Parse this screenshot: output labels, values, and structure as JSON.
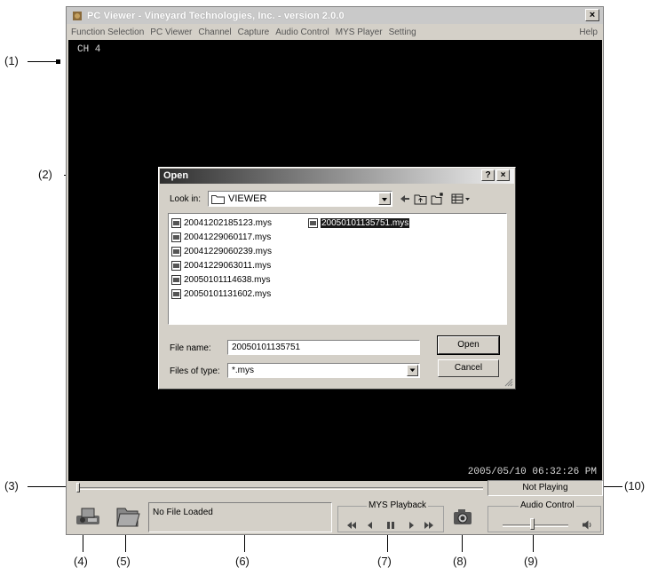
{
  "window": {
    "title": "PC Viewer - Vineyard Technologies, Inc. - version 2.0.0",
    "close_glyph": "×"
  },
  "menu": {
    "items": [
      "Function Selection",
      "PC Viewer",
      "Channel",
      "Capture",
      "Audio Control",
      "MYS Player",
      "Setting"
    ],
    "help": "Help"
  },
  "video": {
    "channel": "CH 4",
    "timestamp": "2005/05/10 06:32:26 PM"
  },
  "dialog": {
    "title": "Open",
    "help_glyph": "?",
    "close_glyph": "×",
    "look_in_label": "Look in:",
    "look_in_value": "VIEWER",
    "files": [
      "20041202185123.mys",
      "20041229060117.mys",
      "20041229060239.mys",
      "20041229063011.mys",
      "20050101114638.mys",
      "20050101131602.mys",
      "20050101135751.mys"
    ],
    "selected_file_index": 6,
    "file_name_label": "File name:",
    "file_name_value": "20050101135751",
    "file_type_label": "Files of type:",
    "file_type_value": "*.mys",
    "open_label": "Open",
    "cancel_label": "Cancel"
  },
  "status": {
    "play_state": "Not Playing",
    "file_status": "No File Loaded"
  },
  "playback": {
    "title": "MYS Playback",
    "controls": [
      "rewind-icon",
      "step-back-icon",
      "pause-icon",
      "play-icon",
      "fast-forward-icon"
    ]
  },
  "audio": {
    "title": "Audio Control",
    "volume": 0.45
  },
  "callouts": [
    "(1)",
    "(2)",
    "(3)",
    "(4)",
    "(5)",
    "(6)",
    "(7)",
    "(8)",
    "(9)",
    "(10)"
  ]
}
